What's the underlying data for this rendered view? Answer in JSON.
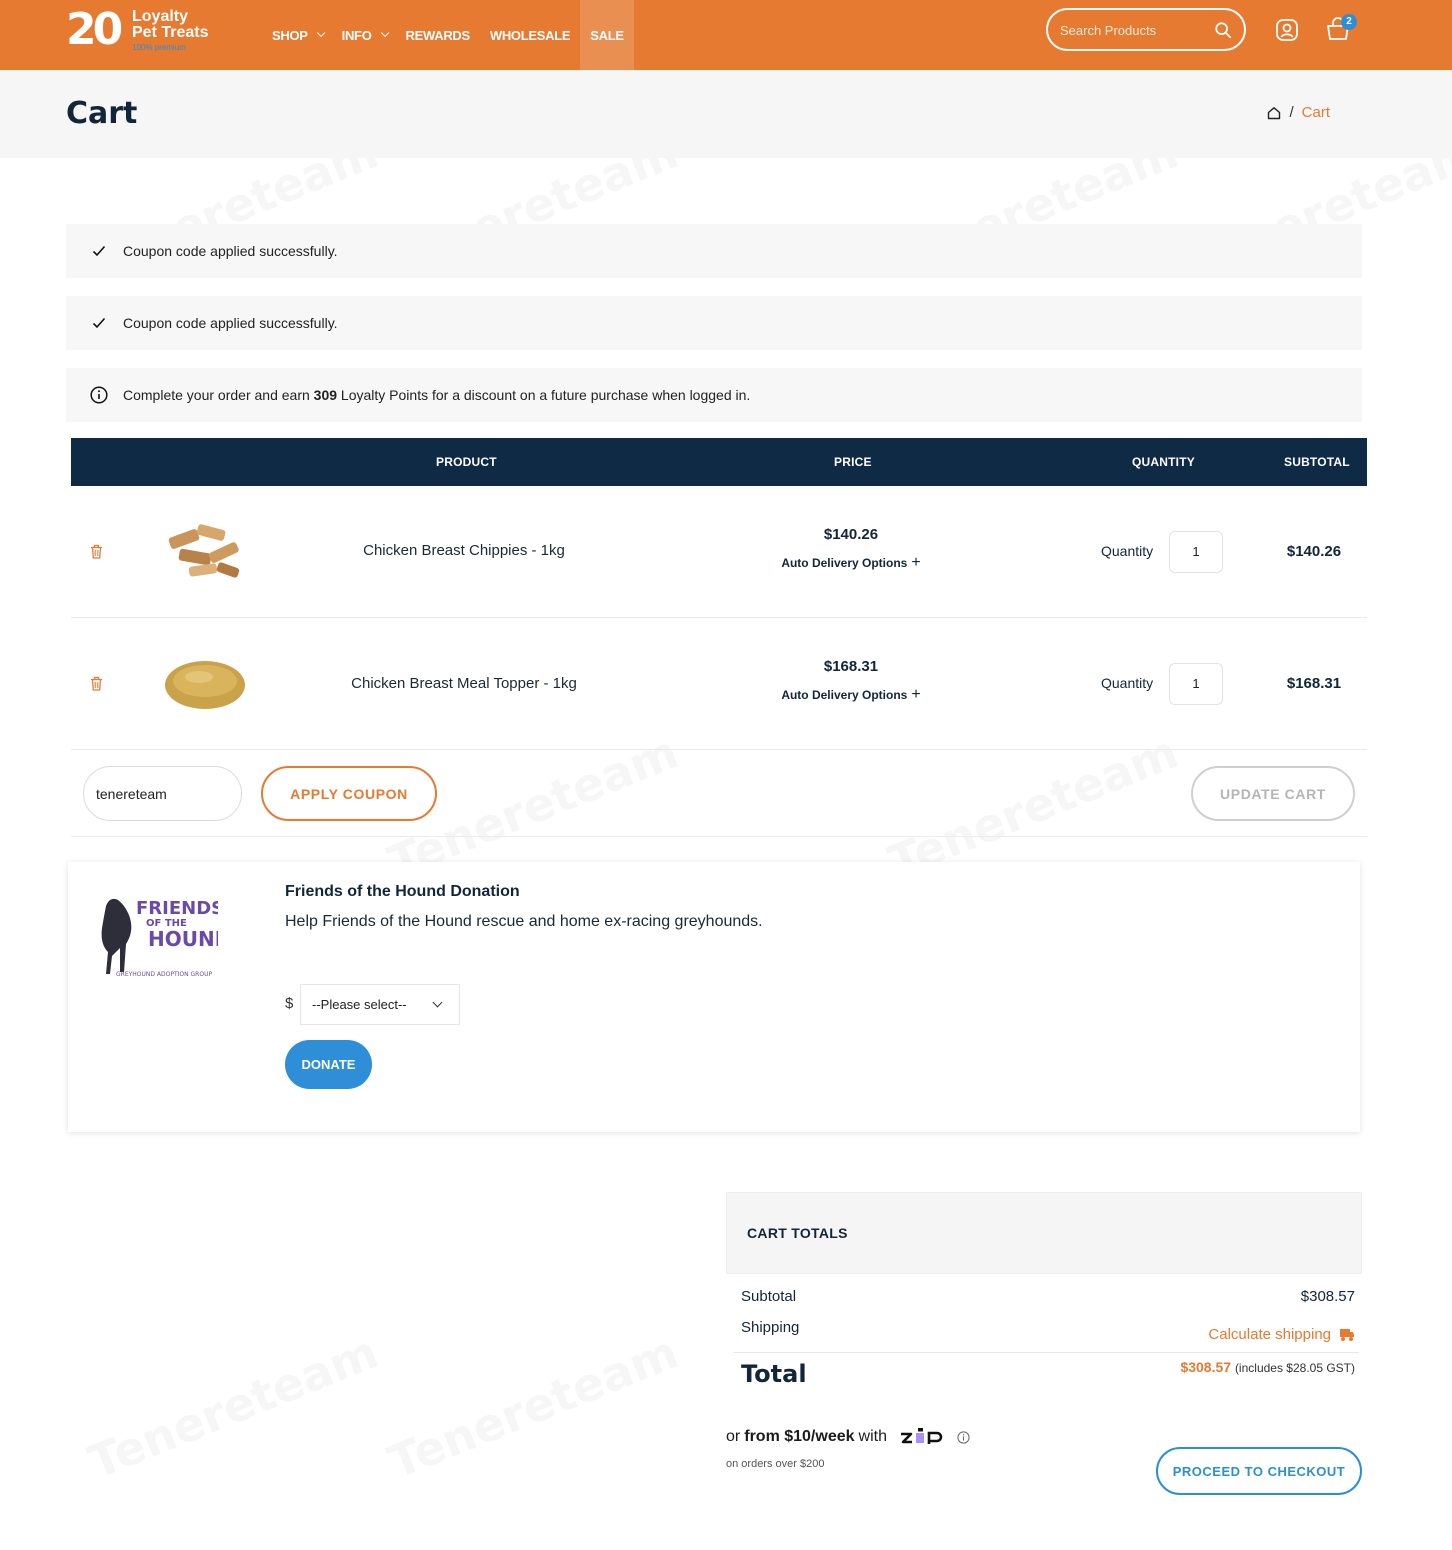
{
  "header": {
    "logo": {
      "number": "20",
      "line1": "Loyalty",
      "line2": "Pet Treats",
      "line3": "100% premium"
    },
    "nav": [
      {
        "label": "SHOP",
        "dropdown": true
      },
      {
        "label": "INFO",
        "dropdown": true
      },
      {
        "label": "REWARDS",
        "dropdown": false
      },
      {
        "label": "WHOLESALE",
        "dropdown": false
      },
      {
        "label": "SALE",
        "dropdown": false
      }
    ],
    "search_placeholder": "Search Products",
    "cart_count": "2",
    "icons": {
      "search": "search-icon",
      "account": "user-icon",
      "cart": "cart-icon"
    }
  },
  "page": {
    "title": "Cart",
    "breadcrumb": {
      "separator": "/",
      "current": "Cart"
    }
  },
  "notices": [
    {
      "icon": "check-icon",
      "text": "Coupon code applied successfully."
    },
    {
      "icon": "check-icon",
      "text": "Coupon code applied successfully."
    },
    {
      "icon": "info-icon",
      "text_before": "Complete your order and earn ",
      "points": "309",
      "text_after": " Loyalty Points for a discount on a future purchase when logged in."
    }
  ],
  "table": {
    "headers": {
      "product": "PRODUCT",
      "price": "PRICE",
      "quantity": "QUANTITY",
      "subtotal": "SUBTOTAL"
    },
    "rows": [
      {
        "name": "Chicken Breast Chippies - 1kg",
        "price": "$140.26",
        "auto_delivery": "Auto Delivery Options",
        "qty_label": "Quantity",
        "qty": "1",
        "subtotal": "$140.26"
      },
      {
        "name": "Chicken Breast Meal Topper - 1kg",
        "price": "$168.31",
        "auto_delivery": "Auto Delivery Options",
        "qty_label": "Quantity",
        "qty": "1",
        "subtotal": "$168.31"
      }
    ]
  },
  "coupon": {
    "value": "tenereteam",
    "apply_label": "APPLY COUPON",
    "update_label": "UPDATE CART"
  },
  "donation": {
    "logo_lines": [
      "FRIENDS",
      "OF THE",
      "HOUND",
      "GREYHOUND ADOPTION GROUP"
    ],
    "title": "Friends of the Hound Donation",
    "description": "Help Friends of the Hound rescue and home ex-racing greyhounds.",
    "currency": "$",
    "select_value": "--Please select--",
    "button": "DONATE"
  },
  "totals": {
    "heading": "CART TOTALS",
    "subtotal_label": "Subtotal",
    "subtotal_value": "$308.57",
    "shipping_label": "Shipping",
    "shipping_action": "Calculate shipping",
    "total_label": "Total",
    "total_value": "$308.57",
    "total_tax_note": "(includes $28.05 GST)",
    "zip_prefix": "or",
    "zip_amount": "from $10/week",
    "zip_suffix": "with",
    "zip_note": "on orders over $200",
    "checkout_label": "PROCEED TO CHECKOUT"
  },
  "watermark": "Tenereteam",
  "colors": {
    "brand_orange": "#e57a30",
    "navy": "#0f2a44",
    "blue": "#2b8fd6"
  }
}
